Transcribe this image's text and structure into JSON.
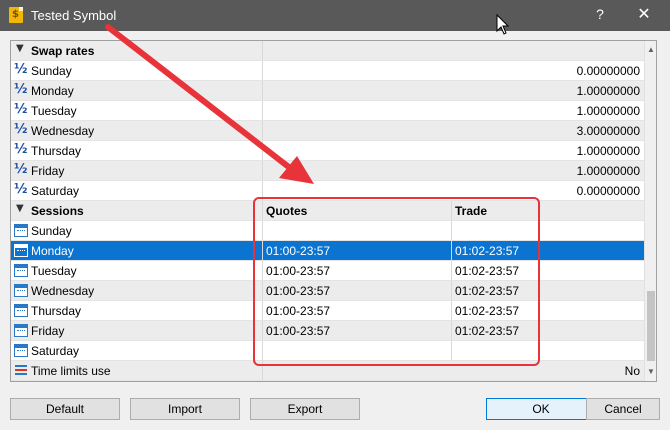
{
  "window": {
    "title": "Tested Symbol",
    "help_label": "?",
    "close_label": "✕"
  },
  "swap": {
    "label": "Swap rates",
    "rows": [
      {
        "day": "Sunday",
        "value": "0.00000000"
      },
      {
        "day": "Monday",
        "value": "1.00000000"
      },
      {
        "day": "Tuesday",
        "value": "1.00000000"
      },
      {
        "day": "Wednesday",
        "value": "3.00000000"
      },
      {
        "day": "Thursday",
        "value": "1.00000000"
      },
      {
        "day": "Friday",
        "value": "1.00000000"
      },
      {
        "day": "Saturday",
        "value": "0.00000000"
      }
    ]
  },
  "sessions": {
    "label": "Sessions",
    "col_quotes": "Quotes",
    "col_trade": "Trade",
    "rows": [
      {
        "day": "Sunday",
        "quotes": "",
        "trade": ""
      },
      {
        "day": "Monday",
        "quotes": "01:00-23:57",
        "trade": "01:02-23:57"
      },
      {
        "day": "Tuesday",
        "quotes": "01:00-23:57",
        "trade": "01:02-23:57"
      },
      {
        "day": "Wednesday",
        "quotes": "01:00-23:57",
        "trade": "01:02-23:57"
      },
      {
        "day": "Thursday",
        "quotes": "01:00-23:57",
        "trade": "01:02-23:57"
      },
      {
        "day": "Friday",
        "quotes": "01:00-23:57",
        "trade": "01:02-23:57"
      },
      {
        "day": "Saturday",
        "quotes": "",
        "trade": ""
      }
    ]
  },
  "time_limits": {
    "label": "Time limits use",
    "value": "No"
  },
  "buttons": {
    "default": "Default",
    "import": "Import",
    "export": "Export",
    "ok": "OK",
    "cancel": "Cancel"
  },
  "colors": {
    "selection": "#0a74d0",
    "annotation": "#e8333a",
    "titlebar": "#595959"
  }
}
